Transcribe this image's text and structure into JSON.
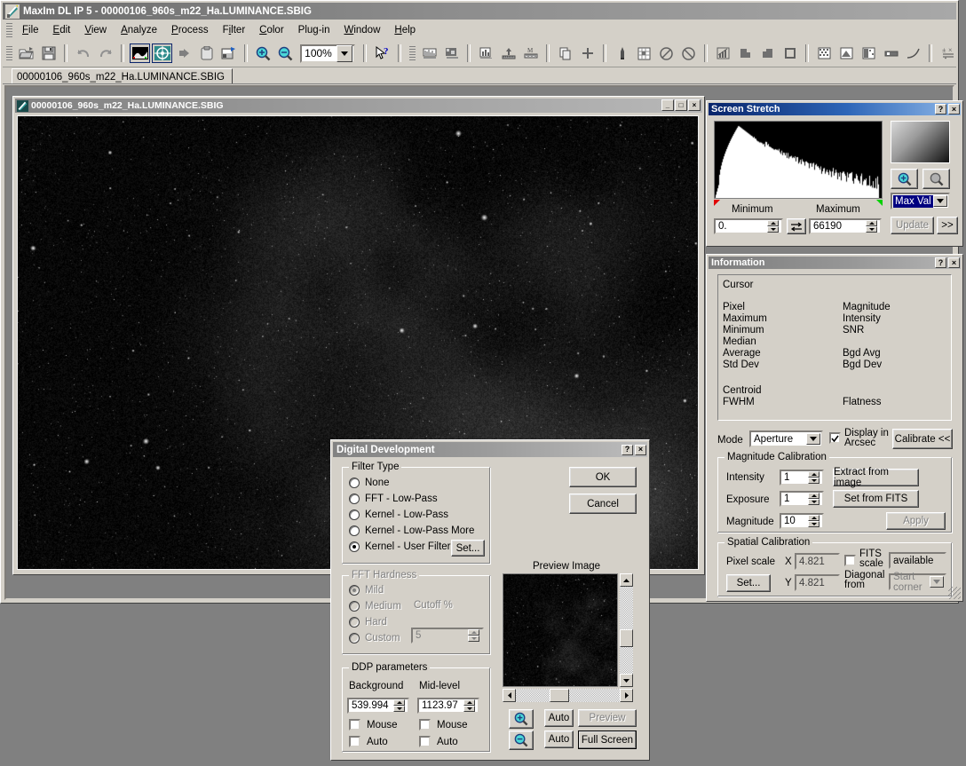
{
  "app": {
    "title": "MaxIm DL IP 5 - 00000106_960s_m22_Ha.LUMINANCE.SBIG",
    "icon": "telescope-icon"
  },
  "menu": {
    "items": [
      {
        "label": "File",
        "accel": "F"
      },
      {
        "label": "Edit",
        "accel": "E"
      },
      {
        "label": "View",
        "accel": "V"
      },
      {
        "label": "Analyze",
        "accel": "A"
      },
      {
        "label": "Process",
        "accel": "P"
      },
      {
        "label": "Filter",
        "accel": "i"
      },
      {
        "label": "Color",
        "accel": "C"
      },
      {
        "label": "Plug-in",
        "accel": "g"
      },
      {
        "label": "Window",
        "accel": "W"
      },
      {
        "label": "Help",
        "accel": "H"
      }
    ]
  },
  "toolbar": {
    "zoom_value": "100%",
    "buttons": [
      "open-icon",
      "save-icon",
      "undo-icon",
      "redo-icon",
      "screen-stretch-icon",
      "information-icon",
      "fit-icon",
      "clipboard-icon",
      "edit-fits-icon",
      "zoom-in-icon",
      "zoom-out-icon",
      "help-cursor-icon",
      "line-profile-icon",
      "area-profile-icon",
      "histogram-icon",
      "pixel-math-icon",
      "measure-icon",
      "copy-icon",
      "plus-icon",
      "color-pick-icon",
      "grid-icon",
      "half-circle-icon",
      "half-circle-alt-icon",
      "graph-icon",
      "polygon-icon",
      "polygon-alt-icon",
      "square-icon",
      "noise-icon",
      "noise-alt-icon",
      "noise-alt2-icon",
      "rect-icon",
      "curve-icon",
      "math-icon"
    ]
  },
  "tabs": [
    {
      "label": "00000106_960s_m22_Ha.LUMINANCE.SBIG",
      "active": true
    }
  ],
  "image_window": {
    "title": "00000106_960s_m22_Ha.LUMINANCE.SBIG",
    "icon": "telescope-icon",
    "minimize": "_",
    "maximize": "□",
    "close": "×"
  },
  "screen_stretch": {
    "title": "Screen Stretch",
    "help_label": "?",
    "close_label": "×",
    "minimum_label": "Minimum",
    "maximum_label": "Maximum",
    "minimum_value": "0.",
    "maximum_value": "66190",
    "swap_icon": "swap-arrows-icon",
    "zoom_in_icon": "zoom-in-icon",
    "zoom_out_icon": "zoom-out-icon",
    "mode_value": "Max Val",
    "update_label": "Update",
    "expand_label": ">>"
  },
  "information": {
    "title": "Information",
    "help_label": "?",
    "close_label": "×",
    "cursor_label": "Cursor",
    "left_fields": [
      "Pixel",
      "Maximum",
      "Minimum",
      "Median",
      "Average",
      "Std Dev"
    ],
    "right_fields": [
      "Magnitude",
      "Intensity",
      "SNR",
      "",
      "Bgd Avg",
      "Bgd Dev"
    ],
    "centroid_label": "Centroid",
    "fwhm_label": "FWHM",
    "flatness_label": "Flatness",
    "mode_label": "Mode",
    "mode_value": "Aperture",
    "display_arcsec_label": "Display in Arcsec",
    "display_arcsec_checked": true,
    "calibrate_label": "Calibrate <<",
    "magnitude_calibration": {
      "legend": "Magnitude Calibration",
      "intensity_label": "Intensity",
      "intensity_value": "1",
      "exposure_label": "Exposure",
      "exposure_value": "1",
      "magnitude_label": "Magnitude",
      "magnitude_value": "10",
      "extract_label": "Extract from image",
      "set_fits_label": "Set from FITS",
      "apply_label": "Apply"
    },
    "spatial_calibration": {
      "legend": "Spatial Calibration",
      "pixel_scale_label": "Pixel scale",
      "x_label": "X",
      "x_value": "4.821",
      "y_label": "Y",
      "y_value": "4.821",
      "set_label": "Set...",
      "fits_scale_label": "FITS scale",
      "fits_scale_checked": false,
      "available_value": "available",
      "diagonal_from_label": "Diagonal from",
      "start_corner_value": "Start corner"
    }
  },
  "ddp_dialog": {
    "title": "Digital Development",
    "help_label": "?",
    "close_label": "×",
    "ok_label": "OK",
    "cancel_label": "Cancel",
    "filter_type": {
      "legend": "Filter Type",
      "options": [
        {
          "label": "None",
          "selected": false
        },
        {
          "label": "FFT - Low-Pass",
          "selected": false
        },
        {
          "label": "Kernel - Low-Pass",
          "selected": false
        },
        {
          "label": "Kernel - Low-Pass More",
          "selected": false
        },
        {
          "label": "Kernel - User Filter",
          "selected": true
        }
      ],
      "set_label": "Set..."
    },
    "fft_hardness": {
      "legend": "FFT Hardness",
      "options": [
        {
          "label": "Mild",
          "selected": true
        },
        {
          "label": "Medium",
          "selected": false
        },
        {
          "label": "Hard",
          "selected": false
        },
        {
          "label": "Custom",
          "selected": false
        }
      ],
      "cutoff_label": "Cutoff %",
      "cutoff_value": "5"
    },
    "ddp_parameters": {
      "legend": "DDP parameters",
      "background_label": "Background",
      "background_value": "539.994",
      "midlevel_label": "Mid-level",
      "midlevel_value": "1123.97",
      "bg_mouse_label": "Mouse",
      "bg_mouse_checked": false,
      "bg_auto_label": "Auto",
      "bg_auto_checked": false,
      "mid_mouse_label": "Mouse",
      "mid_mouse_checked": false,
      "mid_auto_label": "Auto",
      "mid_auto_checked": false
    },
    "preview": {
      "label": "Preview Image",
      "zoom_in_icon": "zoom-in-icon",
      "zoom_out_icon": "zoom-out-icon",
      "auto_top_label": "Auto",
      "auto_bottom_label": "Auto",
      "preview_label": "Preview",
      "fullscreen_label": "Full Screen"
    }
  },
  "colors": {
    "desktop": "#808080",
    "face": "#d4d0c8",
    "title_active": "#08246a",
    "highlight": "#000080",
    "marker_low": "#e00000",
    "marker_high": "#00d000"
  }
}
